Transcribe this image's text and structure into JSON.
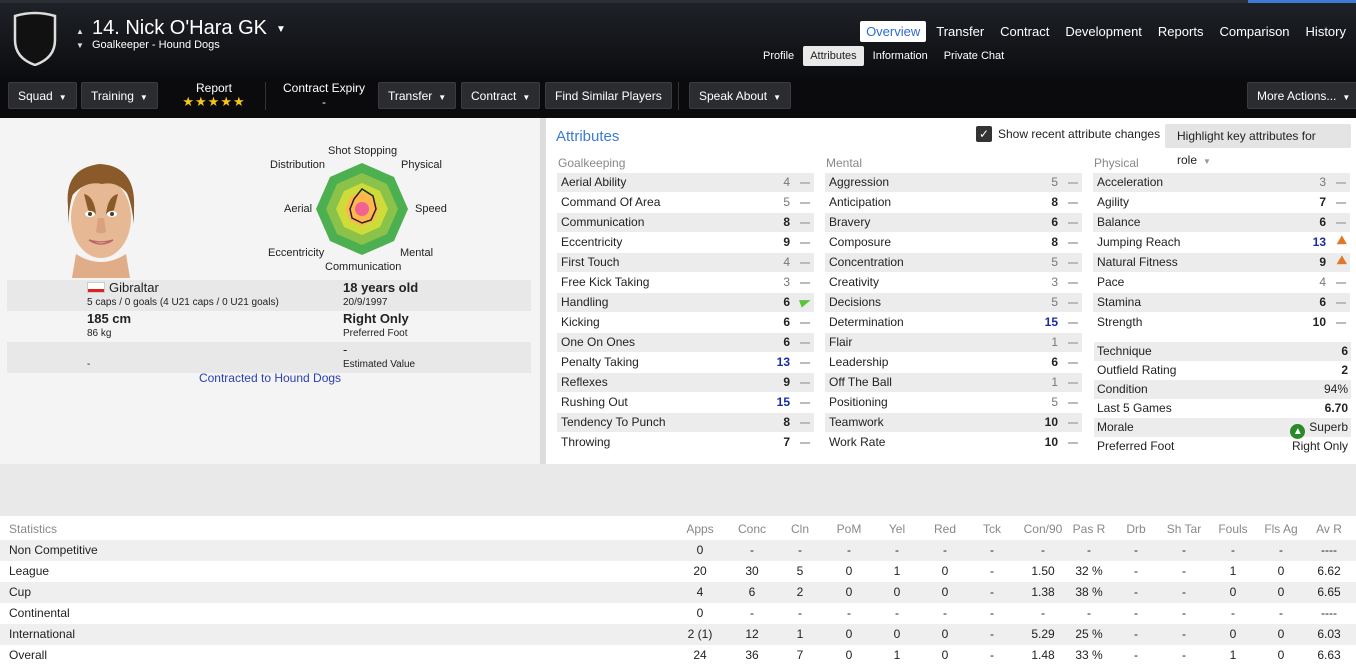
{
  "header": {
    "number_name": "14. Nick O'Hara GK",
    "subtitle": "Goalkeeper - Hound Dogs"
  },
  "main_tabs": [
    {
      "label": "Overview",
      "active": true
    },
    {
      "label": "Transfer"
    },
    {
      "label": "Contract"
    },
    {
      "label": "Development"
    },
    {
      "label": "Reports"
    },
    {
      "label": "Comparison"
    },
    {
      "label": "History"
    }
  ],
  "sub_tabs": [
    {
      "label": "Profile"
    },
    {
      "label": "Attributes",
      "active": true
    },
    {
      "label": "Information"
    },
    {
      "label": "Private Chat"
    }
  ],
  "actions": {
    "squad": "Squad",
    "training": "Training",
    "report_label": "Report",
    "report_stars": "★★★★★",
    "contract_expiry_label": "Contract Expiry",
    "contract_expiry_value": "-",
    "transfer": "Transfer",
    "contract": "Contract",
    "find_similar": "Find Similar Players",
    "speak_about": "Speak About",
    "more_actions": "More Actions..."
  },
  "radar": {
    "labels": {
      "top": "Shot Stopping",
      "top_right": "Physical",
      "right": "Speed",
      "bottom_right": "Mental",
      "bottom": "Communication",
      "bottom_left": "Eccentricity",
      "left": "Aerial",
      "top_left": "Distribution"
    }
  },
  "profile": {
    "nation": "Gibraltar",
    "caps": "5 caps / 0 goals (4 U21 caps / 0 U21 goals)",
    "age": "18 years old",
    "dob": "20/9/1997",
    "height": "185 cm",
    "weight": "86 kg",
    "foot": "Right Only",
    "foot_label": "Preferred Foot",
    "value_left": "-",
    "value": "-",
    "value_label": "Estimated Value",
    "contracted": "Contracted to Hound Dogs"
  },
  "attributes": {
    "title": "Attributes",
    "show_changes": "Show recent attribute changes",
    "highlight": "Highlight key attributes for role",
    "goalkeeping_title": "Goalkeeping",
    "mental_title": "Mental",
    "physical_title": "Physical",
    "goalkeeping": [
      {
        "name": "Aerial Ability",
        "value": "4"
      },
      {
        "name": "Command Of Area",
        "value": "5"
      },
      {
        "name": "Communication",
        "value": "8"
      },
      {
        "name": "Eccentricity",
        "value": "9"
      },
      {
        "name": "First Touch",
        "value": "4"
      },
      {
        "name": "Free Kick Taking",
        "value": "3"
      },
      {
        "name": "Handling",
        "value": "6"
      },
      {
        "name": "Kicking",
        "value": "6"
      },
      {
        "name": "One On Ones",
        "value": "6"
      },
      {
        "name": "Penalty Taking",
        "value": "13"
      },
      {
        "name": "Reflexes",
        "value": "9"
      },
      {
        "name": "Rushing Out",
        "value": "15"
      },
      {
        "name": "Tendency To Punch",
        "value": "8"
      },
      {
        "name": "Throwing",
        "value": "7"
      }
    ],
    "mental": [
      {
        "name": "Aggression",
        "value": "5"
      },
      {
        "name": "Anticipation",
        "value": "8"
      },
      {
        "name": "Bravery",
        "value": "6"
      },
      {
        "name": "Composure",
        "value": "8"
      },
      {
        "name": "Concentration",
        "value": "5"
      },
      {
        "name": "Creativity",
        "value": "3"
      },
      {
        "name": "Decisions",
        "value": "5"
      },
      {
        "name": "Determination",
        "value": "15"
      },
      {
        "name": "Flair",
        "value": "1"
      },
      {
        "name": "Leadership",
        "value": "6"
      },
      {
        "name": "Off The Ball",
        "value": "1"
      },
      {
        "name": "Positioning",
        "value": "5"
      },
      {
        "name": "Teamwork",
        "value": "10"
      },
      {
        "name": "Work Rate",
        "value": "10"
      }
    ],
    "physical": [
      {
        "name": "Acceleration",
        "value": "3"
      },
      {
        "name": "Agility",
        "value": "7"
      },
      {
        "name": "Balance",
        "value": "6"
      },
      {
        "name": "Jumping Reach",
        "value": "13"
      },
      {
        "name": "Natural Fitness",
        "value": "9"
      },
      {
        "name": "Pace",
        "value": "4"
      },
      {
        "name": "Stamina",
        "value": "6"
      },
      {
        "name": "Strength",
        "value": "10"
      }
    ],
    "misc": [
      {
        "name": "Technique",
        "value": "6"
      },
      {
        "name": "Outfield Rating",
        "value": "2"
      },
      {
        "name": "Condition",
        "value": "94%"
      },
      {
        "name": "Last 5 Games",
        "value": "6.70"
      },
      {
        "name": "Morale",
        "value": "Superb"
      },
      {
        "name": "Preferred Foot",
        "value": "Right Only"
      }
    ]
  },
  "statistics": {
    "headers": [
      "Statistics",
      "Apps",
      "Conc",
      "Cln",
      "PoM",
      "Yel",
      "Red",
      "Tck",
      "Con/90",
      "Pas R",
      "Drb",
      "Sh Tar",
      "Fouls",
      "Fls Ag",
      "Av R"
    ],
    "rows": [
      [
        "Non Competitive",
        "0",
        "-",
        "-",
        "-",
        "-",
        "-",
        "-",
        "-",
        "-",
        "-",
        "-",
        "-",
        "-",
        "----"
      ],
      [
        "League",
        "20",
        "30",
        "5",
        "0",
        "1",
        "0",
        "-",
        "1.50",
        "32 %",
        "-",
        "-",
        "1",
        "0",
        "6.62"
      ],
      [
        "Cup",
        "4",
        "6",
        "2",
        "0",
        "0",
        "0",
        "-",
        "1.38",
        "38 %",
        "-",
        "-",
        "0",
        "0",
        "6.65"
      ],
      [
        "Continental",
        "0",
        "-",
        "-",
        "-",
        "-",
        "-",
        "-",
        "-",
        "-",
        "-",
        "-",
        "-",
        "-",
        "----"
      ],
      [
        "International",
        "2 (1)",
        "12",
        "1",
        "0",
        "0",
        "0",
        "-",
        "5.29",
        "25 %",
        "-",
        "-",
        "0",
        "0",
        "6.03"
      ],
      [
        "Overall",
        "24",
        "36",
        "7",
        "0",
        "1",
        "0",
        "-",
        "1.48",
        "33 %",
        "-",
        "-",
        "1",
        "0",
        "6.63"
      ]
    ]
  },
  "colors": {
    "accent": "#3a7bd5",
    "high_attr": "#1a2aa0",
    "star": "#f5c518"
  }
}
